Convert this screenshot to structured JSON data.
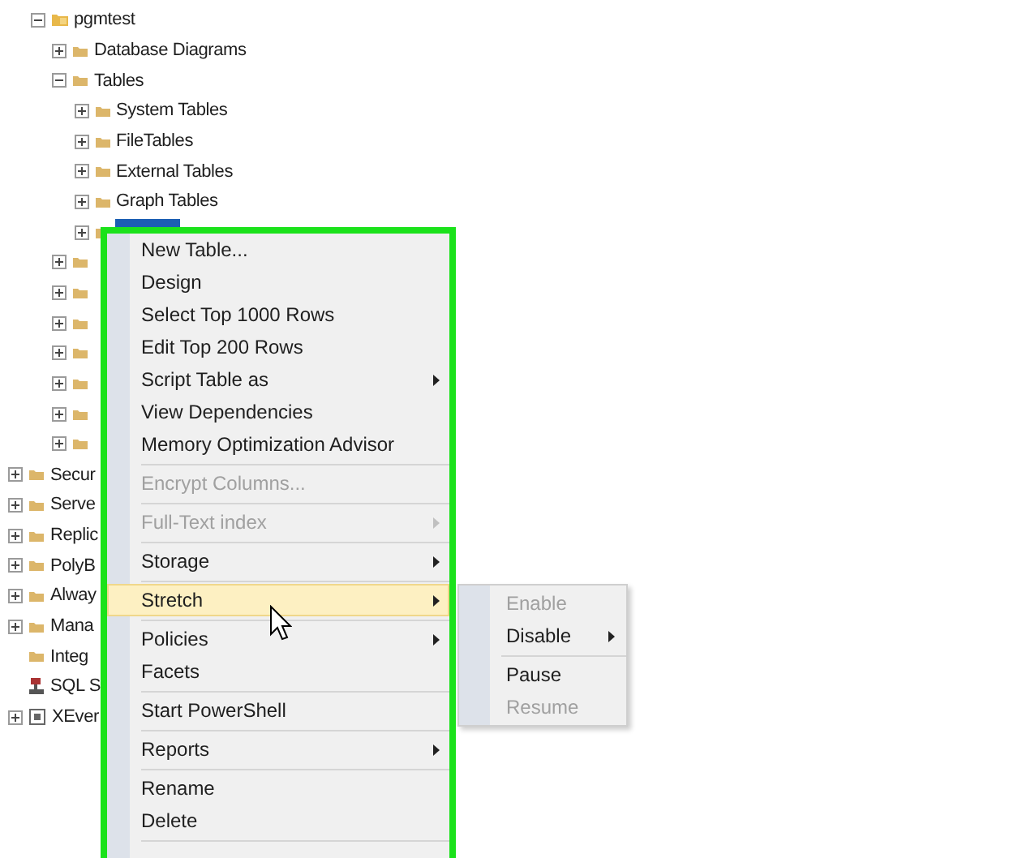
{
  "databases_folder": {
    "children": [
      {
        "label": "pgmtest",
        "kind": "database",
        "expanded": true,
        "children": [
          {
            "label": "Database Diagrams",
            "kind": "folder",
            "expanded": false
          },
          {
            "label": "Tables",
            "kind": "folder",
            "expanded": true,
            "children": [
              {
                "label": "System Tables",
                "kind": "folder",
                "expanded": false
              },
              {
                "label": "FileTables",
                "kind": "folder",
                "expanded": false
              },
              {
                "label": "External Tables",
                "kind": "folder",
                "expanded": false
              },
              {
                "label": "Graph Tables",
                "kind": "folder",
                "expanded": false
              },
              {
                "kind": "folder",
                "expanded": false,
                "selected": true
              }
            ]
          },
          {
            "kind": "folder",
            "expanded": false
          },
          {
            "kind": "folder",
            "expanded": false
          },
          {
            "kind": "folder",
            "expanded": false
          },
          {
            "kind": "folder",
            "expanded": false
          },
          {
            "kind": "folder",
            "expanded": false
          },
          {
            "kind": "folder",
            "expanded": false
          },
          {
            "kind": "folder",
            "expanded": false
          }
        ]
      }
    ]
  },
  "server_items": [
    {
      "label": "Secur",
      "kind": "folder",
      "expanded": false
    },
    {
      "label": "Serve",
      "kind": "folder",
      "expanded": false
    },
    {
      "label": "Replic",
      "kind": "folder",
      "expanded": false
    },
    {
      "label": "PolyB",
      "kind": "folder",
      "expanded": false
    },
    {
      "label": "Alway",
      "kind": "folder",
      "expanded": false
    },
    {
      "label": "Mana",
      "kind": "folder",
      "expanded": false
    },
    {
      "label": "Integ",
      "kind": "folder"
    },
    {
      "label": "SQL S",
      "kind": "agent"
    },
    {
      "label": "XEver",
      "kind": "xevent",
      "expanded": false
    }
  ],
  "context_menu": {
    "items": [
      {
        "kind": "item",
        "label": "New Table...",
        "disabled": false,
        "submenu": false,
        "selected": false
      },
      {
        "kind": "item",
        "label": "Design",
        "disabled": false,
        "submenu": false,
        "selected": false
      },
      {
        "kind": "item",
        "label": "Select Top 1000 Rows",
        "disabled": false,
        "submenu": false,
        "selected": false
      },
      {
        "kind": "item",
        "label": "Edit Top 200 Rows",
        "disabled": false,
        "submenu": false,
        "selected": false
      },
      {
        "kind": "item",
        "label": "Script Table as",
        "disabled": false,
        "submenu": true,
        "selected": false
      },
      {
        "kind": "item",
        "label": "View Dependencies",
        "disabled": false,
        "submenu": false,
        "selected": false
      },
      {
        "kind": "item",
        "label": "Memory Optimization Advisor",
        "disabled": false,
        "submenu": false,
        "selected": false
      },
      {
        "kind": "separator"
      },
      {
        "kind": "item",
        "label": "Encrypt Columns...",
        "disabled": true,
        "submenu": false,
        "selected": false
      },
      {
        "kind": "separator"
      },
      {
        "kind": "item",
        "label": "Full-Text index",
        "disabled": true,
        "submenu": true,
        "selected": false
      },
      {
        "kind": "separator"
      },
      {
        "kind": "item",
        "label": "Storage",
        "disabled": false,
        "submenu": true,
        "selected": false
      },
      {
        "kind": "separator"
      },
      {
        "kind": "item",
        "label": "Stretch",
        "disabled": false,
        "submenu": true,
        "selected": true
      },
      {
        "kind": "separator"
      },
      {
        "kind": "item",
        "label": "Policies",
        "disabled": false,
        "submenu": true,
        "selected": false
      },
      {
        "kind": "item",
        "label": "Facets",
        "disabled": false,
        "submenu": false,
        "selected": false
      },
      {
        "kind": "separator"
      },
      {
        "kind": "item",
        "label": "Start PowerShell",
        "disabled": false,
        "submenu": false,
        "selected": false
      },
      {
        "kind": "separator"
      },
      {
        "kind": "item",
        "label": "Reports",
        "disabled": false,
        "submenu": true,
        "selected": false
      },
      {
        "kind": "separator"
      },
      {
        "kind": "item",
        "label": "Rename",
        "disabled": false,
        "submenu": false,
        "selected": false
      },
      {
        "kind": "item",
        "label": "Delete",
        "disabled": false,
        "submenu": false,
        "selected": false
      },
      {
        "kind": "separator"
      }
    ]
  },
  "submenu": {
    "items": [
      {
        "kind": "item",
        "label": "Enable",
        "disabled": true,
        "submenu": false,
        "selected": false
      },
      {
        "kind": "item",
        "label": "Disable",
        "disabled": false,
        "submenu": true,
        "selected": false
      },
      {
        "kind": "separator"
      },
      {
        "kind": "item",
        "label": "Pause",
        "disabled": false,
        "submenu": false,
        "selected": false
      },
      {
        "kind": "item",
        "label": "Resume",
        "disabled": true,
        "submenu": false,
        "selected": false
      }
    ]
  }
}
